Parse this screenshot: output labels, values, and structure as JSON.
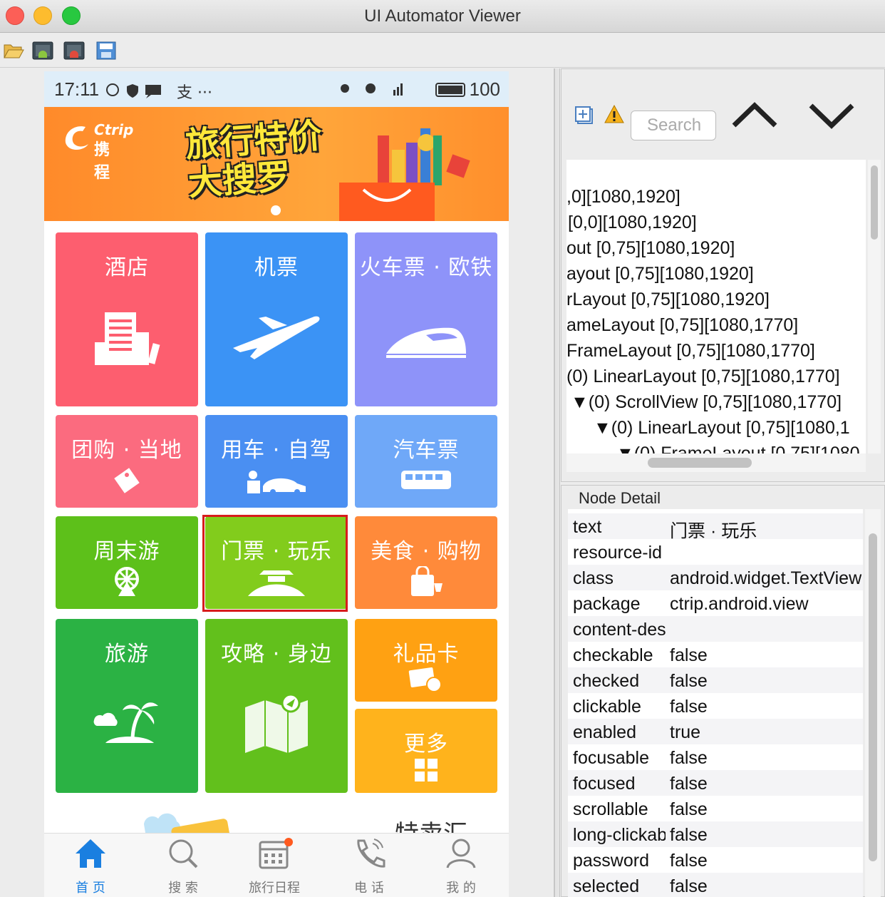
{
  "window": {
    "title": "UI Automator Viewer"
  },
  "toolbar": {
    "icons": [
      "open-folder-icon",
      "device-screenshot-icon",
      "device-screenshot-compressed-icon",
      "save-icon"
    ]
  },
  "phone": {
    "status_time": "17:11",
    "status_extra": "支 ···",
    "battery": "100",
    "banner": {
      "brand_en": "Ctrip",
      "brand_cn": "携程",
      "title_line1": "旅行特价",
      "title_line2": "大搜罗"
    },
    "tiles": {
      "hotel": "酒店",
      "flight": "机票",
      "train": "火车票 · 欧铁",
      "group": "团购 · 当地",
      "car": "用车 · 自驾",
      "bus": "汽车票",
      "weekend": "周末游",
      "tickets": "门票 · 玩乐",
      "food": "美食 · 购物",
      "travel": "旅游",
      "guide": "攻略 · 身边",
      "giftcard": "礼品卡",
      "more": "更多"
    },
    "promo_text": "特卖汇",
    "tabs": {
      "home": "首 页",
      "search": "搜 索",
      "itinerary": "旅行日程",
      "phone": "电 话",
      "mine": "我 的"
    },
    "colors": {
      "hotel": "#fd5e6f",
      "flight": "#3b93f5",
      "train": "#8e93f9",
      "group": "#fb6b7f",
      "car": "#4a8ff2",
      "bus": "#6fa8f8",
      "weekend": "#5dc01a",
      "tickets": "#82cc1c",
      "food": "#ff8a3a",
      "travel": "#2bb244",
      "guide": "#62c01c",
      "giftcard": "#ffa112",
      "more": "#ffb31c"
    }
  },
  "right_panel": {
    "search_placeholder": "Search",
    "tree_rows": [
      ",0][1080,1920]",
      " [0,0][1080,1920]",
      "out [0,75][1080,1920]",
      "ayout [0,75][1080,1920]",
      "rLayout [0,75][1080,1920]",
      "ameLayout [0,75][1080,1770]",
      " FrameLayout [0,75][1080,1770]",
      "(0) LinearLayout [0,75][1080,1770]",
      "▼(0) ScrollView [0,75][1080,1770]",
      "▼(0) LinearLayout [0,75][1080,1",
      "▼(0) FrameLayout [0,75][1080"
    ],
    "detail_title": "Node Detail",
    "detail_rows": [
      {
        "key": "text",
        "value": "门票 · 玩乐"
      },
      {
        "key": "resource-id",
        "value": ""
      },
      {
        "key": "class",
        "value": "android.widget.TextView"
      },
      {
        "key": "package",
        "value": "ctrip.android.view"
      },
      {
        "key": "content-desc",
        "value": ""
      },
      {
        "key": "checkable",
        "value": "false"
      },
      {
        "key": "checked",
        "value": "false"
      },
      {
        "key": "clickable",
        "value": "false"
      },
      {
        "key": "enabled",
        "value": "true"
      },
      {
        "key": "focusable",
        "value": "false"
      },
      {
        "key": "focused",
        "value": "false"
      },
      {
        "key": "scrollable",
        "value": "false"
      },
      {
        "key": "long-clickable",
        "value": "false"
      },
      {
        "key": "password",
        "value": "false"
      },
      {
        "key": "selected",
        "value": "false"
      }
    ]
  }
}
